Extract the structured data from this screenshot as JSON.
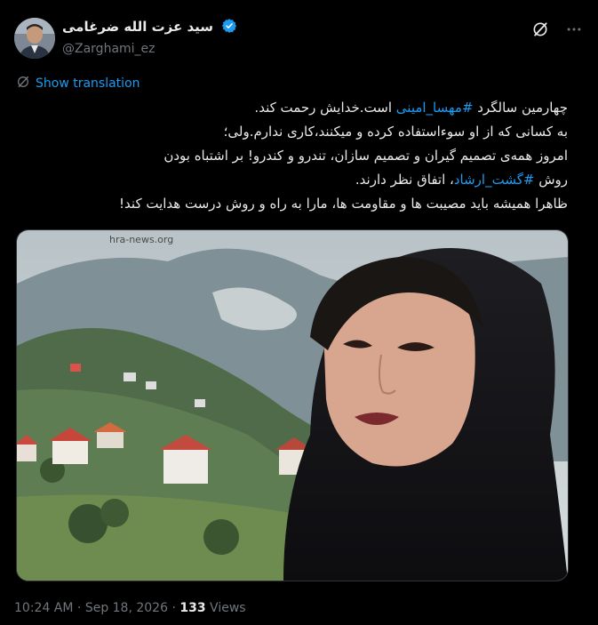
{
  "author": {
    "display_name": "سید عزت الله ضرغامی",
    "handle": "@Zarghami_ez",
    "verified": true
  },
  "header_icons": [
    "grok-icon",
    "more-icon"
  ],
  "translate_label": "Show translation",
  "tweet": {
    "line1_pre": "چهارمین سالگرد ",
    "line1_hashtag": "#مهسا_امینی",
    "line1_post": " است.خدایش رحمت کند.",
    "line2": "به کسانی که از او سوءاستفاده کرده و میکنند،کاری ندارم.ولی؛",
    "line3": "امروز همه‌ی تصمیم گیران و تصمیم سازان، تندرو و کندرو! بر اشتباه بودن",
    "line4_pre": "روش ",
    "line4_hashtag": "#گشت_ارشاد",
    "line4_post": "، اتفاق نظر دارند.",
    "line5": "ظاهرا همیشه باید مصیبت ها و مقاومت ها، مارا به راه و روش درست هدایت کند!"
  },
  "media": {
    "watermark": "hra-news.org"
  },
  "meta": {
    "time": "10:24 AM",
    "date": "Sep 18, 2026",
    "separator": "·",
    "views_count": "133",
    "views_label": "Views"
  },
  "colors": {
    "background": "#000000",
    "text": "#e7e9ea",
    "muted": "#71767b",
    "accent": "#1d9bf0"
  }
}
